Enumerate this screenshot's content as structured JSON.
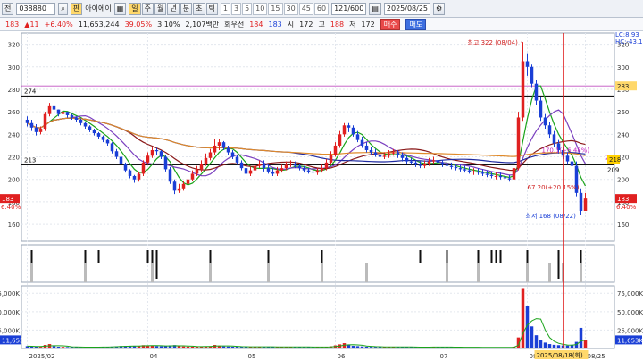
{
  "toolbar": {
    "mode_label": "전",
    "code": "038880",
    "name_badge": "판",
    "name": "아이에이",
    "period_buttons": [
      "일",
      "주",
      "월",
      "년",
      "분",
      "초",
      "틱"
    ],
    "active_period": "일",
    "minute_buttons": [
      "1",
      "3",
      "5",
      "10",
      "15",
      "30",
      "45",
      "60"
    ],
    "count": "121/600",
    "date": "2025/08/25"
  },
  "quote": {
    "price": "183",
    "change": "11",
    "change_pct": "+6.40%",
    "volume": "11,653,244",
    "vol_ratio": "39.05%",
    "turnover": "3.10%",
    "amount": "2,107백만",
    "rank_label": "회우선",
    "bid": "184",
    "ask": "183",
    "open_label": "시",
    "open": "172",
    "high_label": "고",
    "high": "188",
    "low_label": "저",
    "low": "172",
    "buy_label": "매수",
    "sell_label": "매도"
  },
  "price_axis": {
    "ticks": [
      "320",
      "300",
      "280",
      "260",
      "240",
      "220",
      "200",
      "180",
      "160"
    ],
    "right_top_1": "LC:8.93",
    "right_top_2": "HC:-43.17"
  },
  "annotations": {
    "high": "최고 322 (08/04)",
    "low": "최저 168 (08/22)",
    "pct_up": "170.1(~6.48%)",
    "pct_down": "67.20(+20.15%)",
    "level_274": "274",
    "level_213": "213",
    "left_last": "183",
    "left_last_pct": "6.40%",
    "right_283": "283",
    "right_220": "220",
    "right_218": "218",
    "right_209": "209",
    "right_183": "183",
    "right_183_pct": "6.40%"
  },
  "volume_axis": {
    "ticks": [
      "75,000K",
      "50,000K",
      "25,000K"
    ],
    "right_ticks": [
      "75,000K",
      "50,000K",
      "25,000K"
    ],
    "last": "11,653K",
    "left_last": "11,653K"
  },
  "x_axis": {
    "labels": [
      "2025/02",
      "04",
      "05",
      "06",
      "07",
      "08",
      "08/25"
    ],
    "cursor_label": "2025/08/18(화)"
  },
  "colors": {
    "up": "#e02020",
    "down": "#1a3fd6",
    "ma5": "#1aa31a",
    "ma20": "#8b1a1a",
    "ma60": "#1f2aa0",
    "ma120": "#e08a2a",
    "cursor": "#e02020"
  },
  "chart_data": {
    "type": "candlestick",
    "title": "",
    "ylim": [
      145,
      330
    ],
    "vol_ylim": [
      0,
      85000
    ],
    "dates": [
      "02/20",
      "02/21",
      "02/24",
      "02/25",
      "02/26",
      "02/27",
      "02/28",
      "03/04",
      "03/05",
      "03/06",
      "03/07",
      "03/10",
      "03/11",
      "03/12",
      "03/13",
      "03/14",
      "03/17",
      "03/18",
      "03/19",
      "03/20",
      "03/21",
      "03/24",
      "03/25",
      "03/26",
      "03/27",
      "03/28",
      "03/31",
      "04/01",
      "04/02",
      "04/03",
      "04/04",
      "04/07",
      "04/08",
      "04/09",
      "04/10",
      "04/11",
      "04/14",
      "04/15",
      "04/16",
      "04/17",
      "04/18",
      "04/21",
      "04/22",
      "04/23",
      "04/24",
      "04/25",
      "04/28",
      "04/29",
      "04/30",
      "05/02",
      "05/07",
      "05/08",
      "05/09",
      "05/12",
      "05/13",
      "05/14",
      "05/15",
      "05/16",
      "05/19",
      "05/20",
      "05/21",
      "05/22",
      "05/23",
      "05/26",
      "05/27",
      "05/28",
      "05/29",
      "05/30",
      "06/02",
      "06/04",
      "06/05",
      "06/09",
      "06/10",
      "06/11",
      "06/12",
      "06/13",
      "06/16",
      "06/17",
      "06/18",
      "06/19",
      "06/20",
      "06/23",
      "06/24",
      "06/25",
      "06/26",
      "06/27",
      "06/30",
      "07/01",
      "07/02",
      "07/03",
      "07/04",
      "07/07",
      "07/08",
      "07/09",
      "07/10",
      "07/11",
      "07/14",
      "07/15",
      "07/16",
      "07/17",
      "07/18",
      "07/21",
      "07/22",
      "07/23",
      "07/24",
      "07/25",
      "07/28",
      "07/29",
      "07/30",
      "07/31",
      "08/01",
      "08/04",
      "08/05",
      "08/06",
      "08/07",
      "08/08",
      "08/11",
      "08/12",
      "08/13",
      "08/14",
      "08/18",
      "08/19",
      "08/20",
      "08/21",
      "08/22",
      "08/25"
    ],
    "open": [
      253,
      250,
      246,
      242,
      245,
      258,
      265,
      262,
      258,
      260,
      257,
      255,
      253,
      250,
      247,
      244,
      241,
      238,
      235,
      232,
      225,
      220,
      214,
      208,
      203,
      200,
      205,
      215,
      221,
      226,
      225,
      220,
      209,
      198,
      190,
      192,
      196,
      200,
      205,
      209,
      214,
      219,
      224,
      230,
      233,
      228,
      224,
      220,
      215,
      210,
      205,
      208,
      212,
      214,
      210,
      207,
      205,
      208,
      210,
      213,
      214,
      212,
      210,
      208,
      207,
      206,
      208,
      210,
      215,
      222,
      230,
      240,
      248,
      246,
      240,
      235,
      230,
      226,
      224,
      222,
      220,
      221,
      223,
      224,
      222,
      219,
      216,
      215,
      213,
      212,
      214,
      216,
      217,
      215,
      213,
      212,
      211,
      210,
      209,
      208,
      207,
      207,
      206,
      205,
      204,
      203,
      203,
      202,
      201,
      200,
      210,
      255,
      305,
      300,
      285,
      270,
      255,
      248,
      240,
      232,
      226,
      221,
      216,
      212,
      188,
      172
    ],
    "close": [
      250,
      246,
      242,
      245,
      258,
      265,
      262,
      258,
      260,
      257,
      255,
      253,
      250,
      247,
      244,
      241,
      238,
      235,
      232,
      225,
      220,
      214,
      208,
      203,
      200,
      205,
      215,
      221,
      226,
      225,
      220,
      209,
      198,
      190,
      192,
      196,
      200,
      205,
      209,
      214,
      219,
      224,
      230,
      233,
      228,
      224,
      220,
      215,
      210,
      205,
      208,
      212,
      214,
      210,
      207,
      205,
      208,
      210,
      213,
      214,
      212,
      210,
      208,
      207,
      206,
      208,
      210,
      215,
      222,
      230,
      240,
      248,
      246,
      240,
      235,
      230,
      226,
      224,
      222,
      220,
      221,
      223,
      224,
      222,
      219,
      216,
      215,
      213,
      212,
      214,
      216,
      217,
      215,
      213,
      212,
      211,
      210,
      209,
      208,
      207,
      207,
      206,
      205,
      204,
      203,
      203,
      202,
      201,
      200,
      210,
      255,
      305,
      300,
      285,
      270,
      255,
      248,
      240,
      232,
      226,
      221,
      216,
      212,
      188,
      172,
      183
    ],
    "high": [
      256,
      253,
      249,
      247,
      260,
      268,
      267,
      262,
      262,
      260,
      258,
      256,
      254,
      251,
      248,
      245,
      242,
      239,
      236,
      233,
      227,
      221,
      215,
      209,
      204,
      207,
      217,
      224,
      229,
      228,
      226,
      222,
      211,
      200,
      196,
      199,
      203,
      208,
      212,
      217,
      223,
      227,
      236,
      236,
      234,
      230,
      226,
      222,
      217,
      212,
      211,
      215,
      217,
      217,
      213,
      210,
      211,
      213,
      216,
      217,
      216,
      214,
      212,
      210,
      209,
      210,
      213,
      218,
      225,
      233,
      243,
      250,
      250,
      248,
      243,
      238,
      233,
      229,
      227,
      225,
      224,
      226,
      227,
      226,
      224,
      221,
      219,
      217,
      216,
      217,
      219,
      220,
      219,
      217,
      216,
      215,
      214,
      213,
      212,
      211,
      210,
      210,
      209,
      208,
      207,
      206,
      206,
      205,
      204,
      213,
      260,
      322,
      312,
      302,
      288,
      273,
      258,
      251,
      243,
      235,
      229,
      224,
      220,
      216,
      192,
      188
    ],
    "low": [
      247,
      243,
      239,
      240,
      243,
      256,
      259,
      256,
      256,
      255,
      253,
      251,
      248,
      245,
      242,
      239,
      236,
      233,
      230,
      223,
      218,
      212,
      206,
      201,
      197,
      198,
      203,
      213,
      219,
      222,
      218,
      207,
      196,
      187,
      188,
      190,
      196,
      199,
      203,
      207,
      212,
      217,
      222,
      226,
      226,
      222,
      218,
      213,
      208,
      203,
      203,
      206,
      210,
      207,
      205,
      203,
      203,
      206,
      208,
      211,
      210,
      208,
      206,
      205,
      204,
      204,
      206,
      208,
      213,
      220,
      228,
      238,
      242,
      238,
      233,
      228,
      224,
      222,
      220,
      218,
      218,
      219,
      221,
      219,
      216,
      214,
      213,
      211,
      210,
      210,
      212,
      214,
      213,
      211,
      210,
      209,
      208,
      207,
      206,
      205,
      204,
      204,
      203,
      202,
      201,
      200,
      200,
      199,
      198,
      198,
      208,
      252,
      292,
      282,
      266,
      252,
      245,
      237,
      229,
      223,
      218,
      213,
      208,
      185,
      168,
      172
    ],
    "volume": [
      3200,
      2800,
      2500,
      2300,
      4800,
      6000,
      3100,
      2400,
      2200,
      2000,
      1900,
      1800,
      1700,
      1700,
      1800,
      1900,
      2000,
      2100,
      2200,
      2600,
      3000,
      3300,
      3500,
      3400,
      3300,
      3600,
      4500,
      4200,
      3800,
      3300,
      3000,
      3600,
      4200,
      4600,
      3100,
      2800,
      2600,
      2500,
      2500,
      2600,
      3000,
      3200,
      4800,
      3800,
      2900,
      2700,
      2500,
      2400,
      2300,
      2300,
      2200,
      2300,
      2400,
      2300,
      2200,
      2100,
      2000,
      2100,
      2100,
      2200,
      2100,
      2000,
      1900,
      1900,
      1800,
      1900,
      2000,
      2400,
      3000,
      4200,
      5600,
      7200,
      4800,
      3600,
      3200,
      2800,
      2500,
      2300,
      2200,
      2100,
      2100,
      2100,
      2200,
      2100,
      2000,
      1900,
      1900,
      1800,
      1800,
      1900,
      2000,
      2100,
      2000,
      1900,
      1800,
      1800,
      1700,
      1700,
      1700,
      1600,
      1600,
      1600,
      1500,
      1500,
      1500,
      1500,
      1500,
      1400,
      1400,
      2500,
      15000,
      82000,
      58000,
      30000,
      18000,
      12000,
      8000,
      6000,
      5000,
      4500,
      4200,
      4000,
      5000,
      9000,
      28000,
      11653
    ],
    "ma5_last": 183,
    "ma20_last": 218,
    "ma60_last": 220,
    "ma120_last": 225,
    "annotated_high": {
      "value": 322,
      "date": "08/04"
    },
    "annotated_low": {
      "value": 168,
      "date": "08/22"
    },
    "horizontal_levels": [
      274,
      213
    ],
    "xlabel": "",
    "ylabel": ""
  }
}
